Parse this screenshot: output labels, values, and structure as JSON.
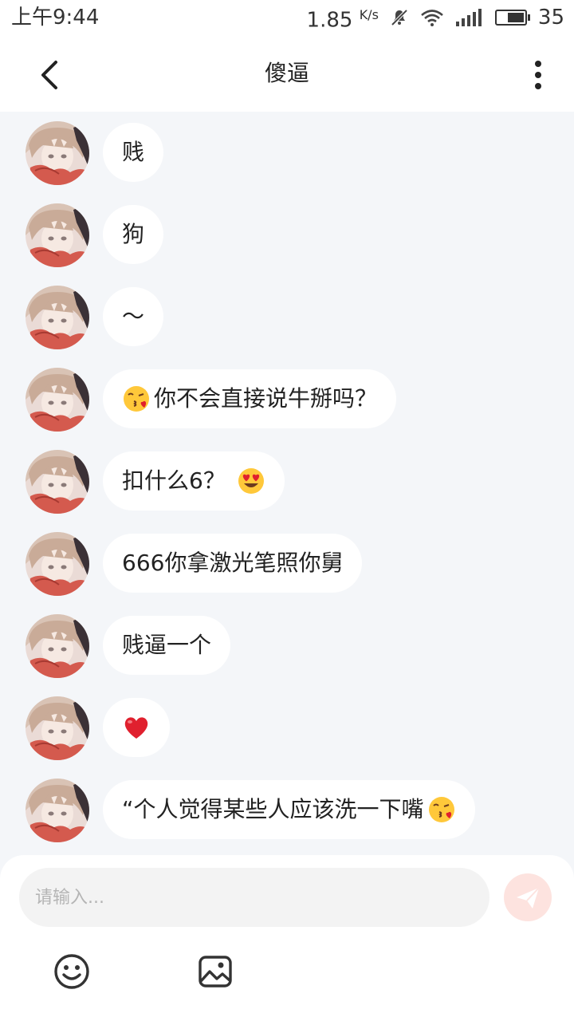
{
  "status_bar": {
    "time": "上午9:44",
    "net_speed": "1.85",
    "net_unit": "K/s",
    "battery": "35"
  },
  "header": {
    "title": "傻逼"
  },
  "messages": [
    {
      "text": "贱",
      "emoji_before": "",
      "emoji_after": ""
    },
    {
      "text": "狗",
      "emoji_before": "",
      "emoji_after": ""
    },
    {
      "text": "～",
      "emoji_before": "",
      "emoji_after": ""
    },
    {
      "text": "你不会直接说牛掰吗？",
      "emoji_before": "face-blowing-kiss",
      "emoji_after": ""
    },
    {
      "text": "扣什么6？",
      "emoji_before": "",
      "emoji_after": "heart-eyes"
    },
    {
      "text": "666你拿激光笔照你舅",
      "emoji_before": "",
      "emoji_after": ""
    },
    {
      "text": "贱逼一个",
      "emoji_before": "",
      "emoji_after": ""
    },
    {
      "text": "",
      "emoji_before": "red-heart",
      "emoji_after": ""
    },
    {
      "text": "“个人觉得某些人应该洗一下嘴",
      "emoji_before": "",
      "emoji_after": "face-blowing-kiss"
    }
  ],
  "composer": {
    "placeholder": "请输入...",
    "send_icon": "paper-plane-icon",
    "emoji_icon": "smiley-icon",
    "image_icon": "image-icon"
  },
  "colors": {
    "chat_background": "#f4f6f9",
    "bubble": "#ffffff",
    "send_button": "#fde3df",
    "send_icon": "#ffffff"
  }
}
